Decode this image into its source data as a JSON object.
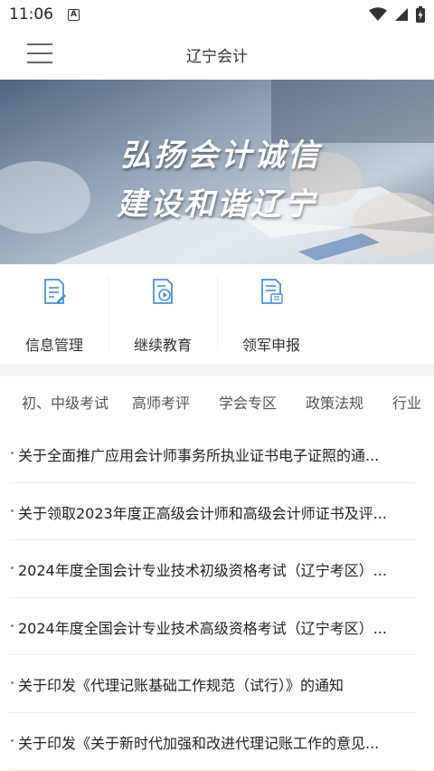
{
  "status_bar": {
    "time": "11:06",
    "notification_icon": "a-notification-icon",
    "icons": [
      "wifi-icon",
      "signal-icon",
      "battery-icon"
    ]
  },
  "app_bar": {
    "title": "辽宁会计",
    "menu_icon": "hamburger-menu-icon"
  },
  "banner": {
    "line1": "弘扬会计诚信",
    "line2": "建设和谐辽宁"
  },
  "quick_menu": [
    {
      "label": "信息管理",
      "icon": "document-edit-icon"
    },
    {
      "label": "继续教育",
      "icon": "video-play-icon"
    },
    {
      "label": "领军申报",
      "icon": "document-apply-icon"
    }
  ],
  "tabs": [
    "初、中级考试",
    "高师考评",
    "学会专区",
    "政策法规",
    "行业"
  ],
  "news": [
    "关于全面推广应用会计师事务所执业证书电子证照的通...",
    "关于领取2023年度正高级会计师和高级会计师证书及评...",
    "2024年度全国会计专业技术初级资格考试（辽宁考区）...",
    "2024年度全国会计专业技术高级资格考试（辽宁考区）...",
    "关于印发《代理记账基础工作规范（试行）》的通知",
    "关于印发《关于新时代加强和改进代理记账工作的意见..."
  ],
  "colors": {
    "icon_blue": "#4a8fd6",
    "text_primary": "#222222",
    "divider": "#ececec"
  }
}
